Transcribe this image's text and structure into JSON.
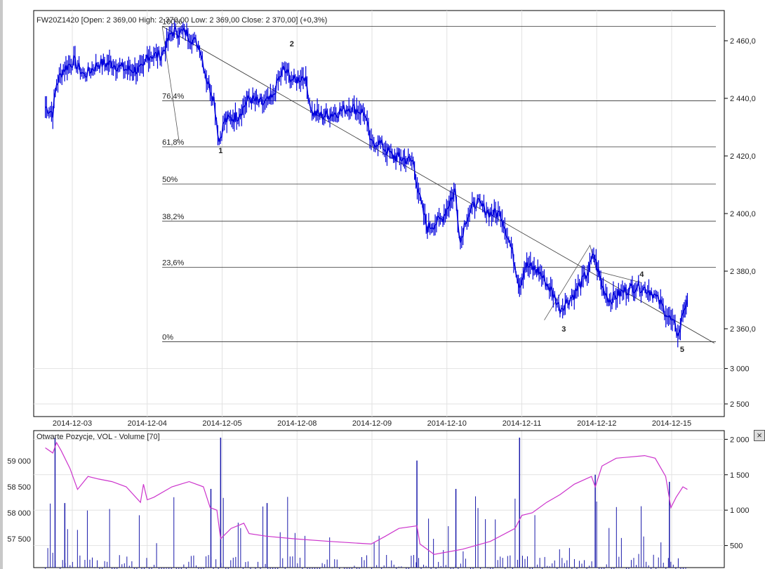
{
  "chart_data": [
    {
      "type": "line",
      "title": "FW20Z1420 [Open: 2 369,00  High: 2 370,00  Low: 2 369,00  Close: 2 370,00] (+0,3%)",
      "x_tick_labels": [
        "2014-12-03",
        "2014-12-04",
        "2014-12-05",
        "2014-12-08",
        "2014-12-09",
        "2014-12-10",
        "2014-12-11",
        "2014-12-12",
        "2014-12-15"
      ],
      "x_note": "x values are trading-day offsets from 2014-12-03",
      "y_tick_values": [
        2460,
        2440,
        2420,
        2400,
        2380,
        2360
      ],
      "y_tick_labels": [
        "2 460,0",
        "2 440,0",
        "2 420,0",
        "2 400,0",
        "2 380,0",
        "2 360,0"
      ],
      "ylim": [
        2335,
        2470
      ],
      "series": [
        {
          "name": "FW20Z1420",
          "color": "#0000dd",
          "x": [
            -0.36,
            -0.26,
            -0.21,
            -0.12,
            0.02,
            0.16,
            0.35,
            0.53,
            0.72,
            0.95,
            1.0,
            1.19,
            1.33,
            1.51,
            1.7,
            1.79,
            1.89,
            1.96,
            2.03,
            2.21,
            2.36,
            2.54,
            2.68,
            2.73,
            2.82,
            2.96,
            3.1,
            3.2,
            3.34,
            3.52,
            3.71,
            3.9,
            3.99,
            4.08,
            4.27,
            4.55,
            4.64,
            4.74,
            4.93,
            5.11,
            5.18,
            5.25,
            5.39,
            5.58,
            5.72,
            5.86,
            5.97,
            6.05,
            6.23,
            6.42,
            6.51,
            6.7,
            6.89,
            6.96,
            7.07,
            7.17,
            7.36,
            7.54,
            7.73,
            7.87,
            8.01,
            8.1,
            8.15,
            8.21
          ],
          "y": [
            2437,
            2435,
            2445,
            2450,
            2453,
            2448,
            2452,
            2452,
            2450,
            2450,
            2455,
            2455,
            2463,
            2463,
            2458,
            2447,
            2440,
            2425,
            2432,
            2434,
            2440,
            2438,
            2440,
            2445,
            2450,
            2446,
            2448,
            2435,
            2434,
            2435,
            2437,
            2435,
            2424,
            2425,
            2420,
            2418,
            2405,
            2395,
            2398,
            2408,
            2390,
            2398,
            2404,
            2400,
            2400,
            2388,
            2375,
            2382,
            2380,
            2372,
            2367,
            2372,
            2380,
            2386,
            2375,
            2370,
            2373,
            2375,
            2373,
            2368,
            2362,
            2358,
            2366,
            2370
          ]
        }
      ],
      "fibonacci": {
        "high": 2465,
        "low": 2355.5,
        "levels": [
          {
            "label": "100%",
            "ratio": 1
          },
          {
            "label": "76,4%",
            "ratio": 0.764
          },
          {
            "label": "61,8%",
            "ratio": 0.618
          },
          {
            "label": "50%",
            "ratio": 0.5
          },
          {
            "label": "38,2%",
            "ratio": 0.382
          },
          {
            "label": "23,6%",
            "ratio": 0.236
          },
          {
            "label": "0%",
            "ratio": 0
          }
        ]
      },
      "wave_labels": [
        {
          "label": "1",
          "x": 1.98,
          "y": 2421
        },
        {
          "label": "2",
          "x": 2.93,
          "y": 2458
        },
        {
          "label": "3",
          "x": 6.56,
          "y": 2359
        },
        {
          "label": "4",
          "x": 7.6,
          "y": 2378
        },
        {
          "label": "5",
          "x": 8.14,
          "y": 2352
        }
      ],
      "trendline": {
        "x0": 1.2,
        "y0": 2465,
        "x1": 8.57,
        "y1": 2355
      }
    },
    {
      "type": "bar",
      "title": "Otwarte Pozycje, VOL - Volume [70]",
      "left_axis": {
        "ticks": [
          59000,
          58500,
          58000,
          57500
        ],
        "labels": [
          "59 000",
          "58 500",
          "58 000",
          "57 500"
        ]
      },
      "right_axis": {
        "ticks": [
          3000,
          2500,
          2000,
          1500,
          1000,
          500
        ],
        "labels": [
          "3 000",
          "2 500",
          "2 000",
          "1 500",
          "1 000",
          "500"
        ]
      },
      "series": [
        {
          "name": "Otwarte Pozycje",
          "type": "line",
          "color": "#cc33cc",
          "x": [
            -0.36,
            -0.26,
            -0.21,
            -0.15,
            -0.03,
            0.07,
            0.21,
            0.35,
            0.53,
            0.72,
            0.91,
            0.95,
            1.0,
            1.09,
            1.33,
            1.56,
            1.75,
            1.84,
            1.93,
            1.98,
            2.12,
            2.29,
            2.36,
            2.59,
            2.96,
            3.43,
            3.99,
            4.18,
            4.36,
            4.6,
            4.64,
            4.83,
            5.21,
            5.58,
            5.91,
            6.0,
            6.14,
            6.33,
            6.51,
            6.7,
            6.93,
            6.98,
            7.07,
            7.26,
            7.64,
            7.78,
            7.92,
            7.99,
            8.06,
            8.15,
            8.21
          ],
          "y": [
            59250,
            59150,
            59350,
            59200,
            58850,
            58450,
            58700,
            58650,
            58600,
            58500,
            58200,
            58550,
            58250,
            58300,
            58500,
            58600,
            58500,
            58100,
            58050,
            57500,
            57700,
            57800,
            57600,
            57550,
            57500,
            57450,
            57400,
            57550,
            57700,
            57750,
            57400,
            57200,
            57300,
            57450,
            57700,
            57950,
            58000,
            58200,
            58350,
            58550,
            58700,
            58500,
            58900,
            59050,
            59100,
            59050,
            58700,
            58100,
            58300,
            58500,
            58450
          ]
        },
        {
          "name": "Volume",
          "type": "bar",
          "color": "#1a1aaa",
          "spikes": [
            {
              "x": -0.23,
              "y": 2200
            },
            {
              "x": 1.98,
              "y": 3100
            },
            {
              "x": 4.6,
              "y": 1700
            },
            {
              "x": 5.97,
              "y": 3600
            },
            {
              "x": 6.98,
              "y": 1500
            },
            {
              "x": 7.97,
              "y": 1400
            },
            {
              "x": -0.1,
              "y": 1100
            },
            {
              "x": 1.85,
              "y": 1300
            },
            {
              "x": 2.6,
              "y": 1100
            },
            {
              "x": 5.12,
              "y": 1300
            }
          ]
        }
      ]
    }
  ],
  "ui": {
    "close_label": "×"
  }
}
